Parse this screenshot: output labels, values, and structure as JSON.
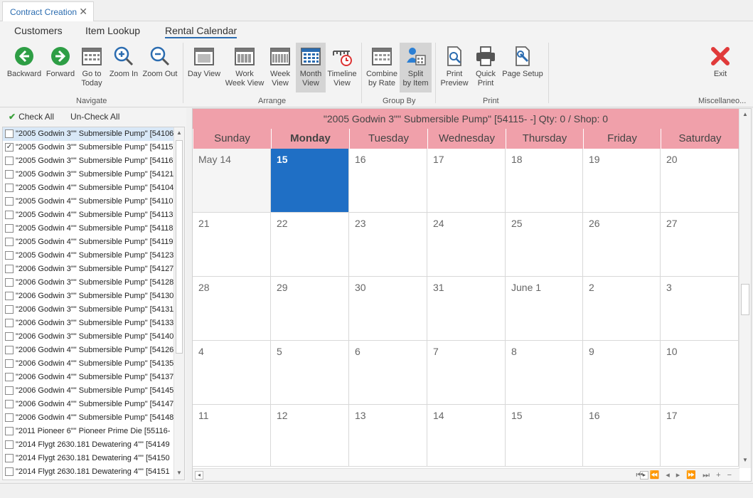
{
  "document_tab": {
    "title": "Contract Creation",
    "close": "✕"
  },
  "ribbon": {
    "tabs": [
      "Customers",
      "Item Lookup",
      "Rental Calendar"
    ],
    "navigate": {
      "label": "Navigate",
      "backward": "Backward",
      "forward": "Forward",
      "goto_today_1": "Go to",
      "goto_today_2": "Today",
      "zoom_in": "Zoom In",
      "zoom_out": "Zoom Out"
    },
    "arrange": {
      "label": "Arrange",
      "day_view": "Day View",
      "work_week_1": "Work",
      "work_week_2": "Week View",
      "week_1": "Week",
      "week_2": "View",
      "month_1": "Month",
      "month_2": "View",
      "timeline_1": "Timeline",
      "timeline_2": "View"
    },
    "group_by": {
      "label": "Group By",
      "combine_1": "Combine",
      "combine_2": "by Rate",
      "split_1": "Split",
      "split_2": "by Item"
    },
    "print": {
      "label": "Print",
      "preview_1": "Print",
      "preview_2": "Preview",
      "quick_1": "Quick",
      "quick_2": "Print",
      "page_setup": "Page Setup"
    },
    "misc": {
      "label": "Miscellaneo...",
      "exit": "Exit"
    }
  },
  "left_panel": {
    "check_all": "Check All",
    "uncheck_all": "Un-Check All",
    "items": [
      {
        "label": "\"2005 Godwin 3\"\" Submersible Pump\" [54106-",
        "checked": false
      },
      {
        "label": "\"2005 Godwin 3\"\" Submersible Pump\" [54115-",
        "checked": true
      },
      {
        "label": "\"2005 Godwin 3\"\" Submersible Pump\" [54116-",
        "checked": false
      },
      {
        "label": "\"2005 Godwin 3\"\" Submersible Pump\" [54121-",
        "checked": false
      },
      {
        "label": "\"2005 Godwin 4\"\" Submersible Pump\" [54104-",
        "checked": false
      },
      {
        "label": "\"2005 Godwin 4\"\" Submersible Pump\" [54110-",
        "checked": false
      },
      {
        "label": "\"2005 Godwin 4\"\" Submersible Pump\" [54113-",
        "checked": false
      },
      {
        "label": "\"2005 Godwin 4\"\" Submersible Pump\" [54118-",
        "checked": false
      },
      {
        "label": "\"2005 Godwin 4\"\" Submersible Pump\" [54119-",
        "checked": false
      },
      {
        "label": "\"2005 Godwin 4\"\" Submersible Pump\" [54123-",
        "checked": false
      },
      {
        "label": "\"2006 Godwin 3\"\" Submersible Pump\" [54127-",
        "checked": false
      },
      {
        "label": "\"2006 Godwin 3\"\" Submersible Pump\" [54128-",
        "checked": false
      },
      {
        "label": "\"2006 Godwin 3\"\" Submersible Pump\" [54130-",
        "checked": false
      },
      {
        "label": "\"2006 Godwin 3\"\" Submersible Pump\" [54131-",
        "checked": false
      },
      {
        "label": "\"2006 Godwin 3\"\" Submersible Pump\" [54133-",
        "checked": false
      },
      {
        "label": "\"2006 Godwin 3\"\" Submersible Pump\" [54140-",
        "checked": false
      },
      {
        "label": "\"2006 Godwin 4\"\" Submersible Pump\" [54126-",
        "checked": false
      },
      {
        "label": "\"2006 Godwin 4\"\" Submersible Pump\" [54135-",
        "checked": false
      },
      {
        "label": "\"2006 Godwin 4\"\" Submersible Pump\" [54137-",
        "checked": false
      },
      {
        "label": "\"2006 Godwin 4\"\" Submersible Pump\" [54145-",
        "checked": false
      },
      {
        "label": "\"2006 Godwin 4\"\" Submersible Pump\" [54147-",
        "checked": false
      },
      {
        "label": "\"2006 Godwin 4\"\" Submersible Pump\" [54148-",
        "checked": false
      },
      {
        "label": "\"2011 Pioneer 6\"\" Pioneer Prime Die [55116-",
        "checked": false
      },
      {
        "label": "\"2014 Flygt 2630.181 Dewatering 4\"\" [54149",
        "checked": false
      },
      {
        "label": "\"2014 Flygt 2630.181 Dewatering 4\"\" [54150",
        "checked": false
      },
      {
        "label": "\"2014 Flygt 2630.181 Dewatering 4\"\" [54151",
        "checked": false
      }
    ]
  },
  "calendar": {
    "title": "\"2005 Godwin 3\"\" Submersible Pump\" [54115-  -] Qty: 0 / Shop: 0",
    "days": [
      "Sunday",
      "Monday",
      "Tuesday",
      "Wednesday",
      "Thursday",
      "Friday",
      "Saturday"
    ],
    "weeks": [
      [
        "May 14",
        "15",
        "16",
        "17",
        "18",
        "19",
        "20"
      ],
      [
        "21",
        "22",
        "23",
        "24",
        "25",
        "26",
        "27"
      ],
      [
        "28",
        "29",
        "30",
        "31",
        "June 1",
        "2",
        "3"
      ],
      [
        "4",
        "5",
        "6",
        "7",
        "8",
        "9",
        "10"
      ],
      [
        "11",
        "12",
        "13",
        "14",
        "15",
        "16",
        "17"
      ]
    ],
    "today_label": "15",
    "nav_glyphs": "⏮ ⏪ ◂ ▸ ⏩ ⏭ + −"
  },
  "colors": {
    "header_pink": "#f0a0aa",
    "today_blue": "#1f6fc5",
    "accent": "#2b6cb0"
  }
}
